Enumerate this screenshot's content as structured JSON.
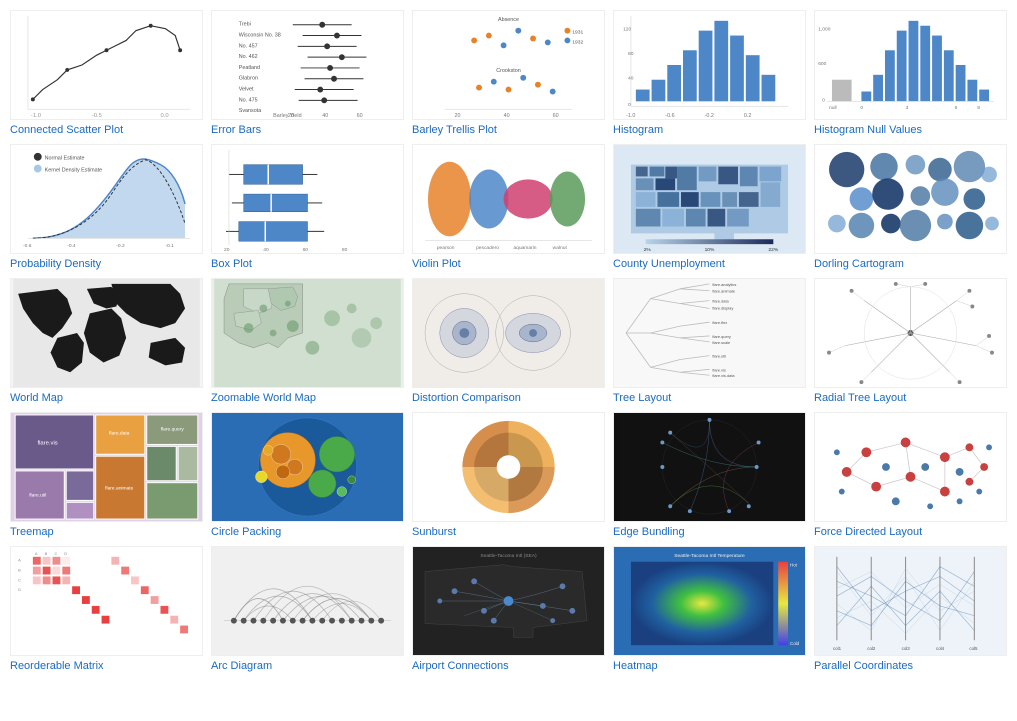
{
  "gallery": {
    "items": [
      {
        "id": "connected-scatter",
        "label": "Connected Scatter Plot",
        "thumb_class": "t-connected-scatter"
      },
      {
        "id": "error-bars",
        "label": "Error Bars",
        "thumb_class": "t-error-bars"
      },
      {
        "id": "barley-trellis",
        "label": "Barley Trellis Plot",
        "thumb_class": "t-barley"
      },
      {
        "id": "histogram",
        "label": "Histogram",
        "thumb_class": "t-histogram"
      },
      {
        "id": "histogram-null",
        "label": "Histogram Null Values",
        "thumb_class": "t-histogram-null"
      },
      {
        "id": "prob-density",
        "label": "Probability Density",
        "thumb_class": "t-prob-density"
      },
      {
        "id": "box-plot",
        "label": "Box Plot",
        "thumb_class": "t-box-plot"
      },
      {
        "id": "violin",
        "label": "Violin Plot",
        "thumb_class": "t-violin"
      },
      {
        "id": "county-unemployment",
        "label": "County Unemployment",
        "thumb_class": "t-county"
      },
      {
        "id": "dorling",
        "label": "Dorling Cartogram",
        "thumb_class": "t-dorling"
      },
      {
        "id": "world-map",
        "label": "World Map",
        "thumb_class": "t-world-map"
      },
      {
        "id": "zoomable-world",
        "label": "Zoomable World Map",
        "thumb_class": "t-zoomable-world"
      },
      {
        "id": "distortion",
        "label": "Distortion Comparison",
        "thumb_class": "t-distortion"
      },
      {
        "id": "tree-layout",
        "label": "Tree Layout",
        "thumb_class": "t-tree"
      },
      {
        "id": "radial-tree",
        "label": "Radial Tree Layout",
        "thumb_class": "t-radial-tree"
      },
      {
        "id": "treemap",
        "label": "Treemap",
        "thumb_class": "t-treemap"
      },
      {
        "id": "circle-packing",
        "label": "Circle Packing",
        "thumb_class": "t-circle-packing"
      },
      {
        "id": "sunburst",
        "label": "Sunburst",
        "thumb_class": "t-sunburst"
      },
      {
        "id": "edge-bundling",
        "label": "Edge Bundling",
        "thumb_class": "t-edge-bundling"
      },
      {
        "id": "force-directed",
        "label": "Force Directed Layout",
        "thumb_class": "t-force"
      },
      {
        "id": "reorderable-matrix",
        "label": "Reorderable Matrix",
        "thumb_class": "t-matrix"
      },
      {
        "id": "arc-diagram",
        "label": "Arc Diagram",
        "thumb_class": "t-arc"
      },
      {
        "id": "airport-connections",
        "label": "Airport Connections",
        "thumb_class": "t-airport"
      },
      {
        "id": "heatmap",
        "label": "Heatmap",
        "thumb_class": "t-heatmap"
      },
      {
        "id": "parallel-coordinates",
        "label": "Parallel Coordinates",
        "thumb_class": "t-parallel"
      }
    ]
  }
}
